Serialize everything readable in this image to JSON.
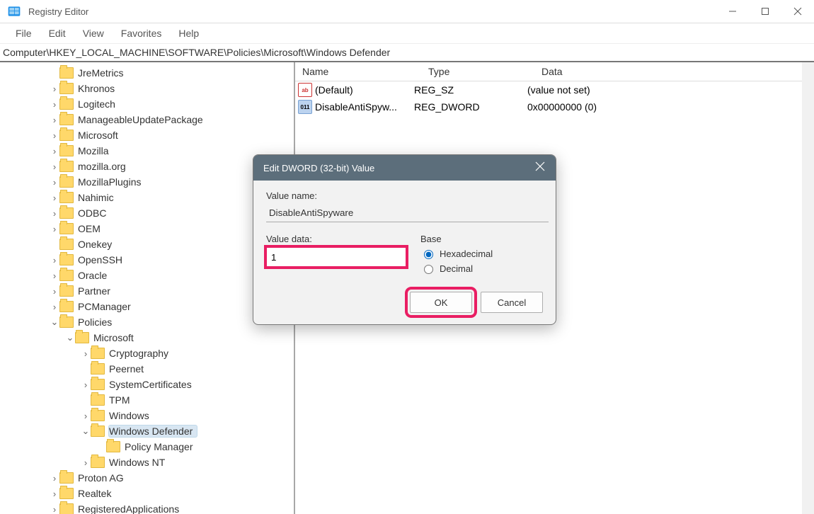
{
  "window": {
    "title": "Registry Editor"
  },
  "menu": {
    "file": "File",
    "edit": "Edit",
    "view": "View",
    "favorites": "Favorites",
    "help": "Help"
  },
  "addressbar": "Computer\\HKEY_LOCAL_MACHINE\\SOFTWARE\\Policies\\Microsoft\\Windows Defender",
  "tree": [
    {
      "level": 0,
      "exp": "",
      "label": "JreMetrics"
    },
    {
      "level": 0,
      "exp": ">",
      "label": "Khronos"
    },
    {
      "level": 0,
      "exp": ">",
      "label": "Logitech"
    },
    {
      "level": 0,
      "exp": ">",
      "label": "ManageableUpdatePackage"
    },
    {
      "level": 0,
      "exp": ">",
      "label": "Microsoft"
    },
    {
      "level": 0,
      "exp": ">",
      "label": "Mozilla"
    },
    {
      "level": 0,
      "exp": ">",
      "label": "mozilla.org"
    },
    {
      "level": 0,
      "exp": ">",
      "label": "MozillaPlugins"
    },
    {
      "level": 0,
      "exp": ">",
      "label": "Nahimic"
    },
    {
      "level": 0,
      "exp": ">",
      "label": "ODBC"
    },
    {
      "level": 0,
      "exp": ">",
      "label": "OEM"
    },
    {
      "level": 0,
      "exp": "",
      "label": "Onekey"
    },
    {
      "level": 0,
      "exp": ">",
      "label": "OpenSSH"
    },
    {
      "level": 0,
      "exp": ">",
      "label": "Oracle"
    },
    {
      "level": 0,
      "exp": ">",
      "label": "Partner"
    },
    {
      "level": 0,
      "exp": ">",
      "label": "PCManager"
    },
    {
      "level": 0,
      "exp": "v",
      "label": "Policies"
    },
    {
      "level": 1,
      "exp": "v",
      "label": "Microsoft"
    },
    {
      "level": 2,
      "exp": ">",
      "label": "Cryptography"
    },
    {
      "level": 2,
      "exp": "",
      "label": "Peernet"
    },
    {
      "level": 2,
      "exp": ">",
      "label": "SystemCertificates"
    },
    {
      "level": 2,
      "exp": "",
      "label": "TPM"
    },
    {
      "level": 2,
      "exp": ">",
      "label": "Windows"
    },
    {
      "level": 2,
      "exp": "v",
      "label": "Windows Defender",
      "selected": true
    },
    {
      "level": 3,
      "exp": "",
      "label": "Policy Manager"
    },
    {
      "level": 2,
      "exp": ">",
      "label": "Windows NT"
    },
    {
      "level": 0,
      "exp": ">",
      "label": "Proton AG"
    },
    {
      "level": 0,
      "exp": ">",
      "label": "Realtek"
    },
    {
      "level": 0,
      "exp": ">",
      "label": "RegisteredApplications"
    }
  ],
  "values": {
    "headers": {
      "name": "Name",
      "type": "Type",
      "data": "Data"
    },
    "rows": [
      {
        "icon": "ab",
        "name": "(Default)",
        "type": "REG_SZ",
        "data": "(value not set)"
      },
      {
        "icon": "01",
        "name": "DisableAntiSpyw...",
        "type": "REG_DWORD",
        "data": "0x00000000 (0)"
      }
    ]
  },
  "dialog": {
    "title": "Edit DWORD (32-bit) Value",
    "value_name_label": "Value name:",
    "value_name": "DisableAntiSpyware",
    "value_data_label": "Value data:",
    "value_data": "1",
    "base_label": "Base",
    "hex_label": "Hexadecimal",
    "dec_label": "Decimal",
    "ok": "OK",
    "cancel": "Cancel"
  }
}
